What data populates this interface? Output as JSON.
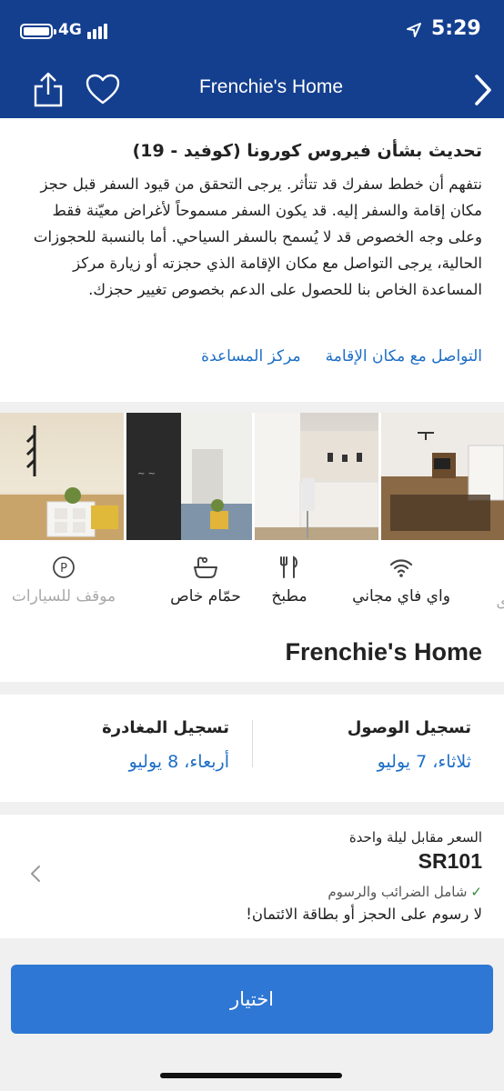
{
  "status_bar": {
    "network": "4G",
    "time": "5:29"
  },
  "nav": {
    "title": "Frenchie's Home"
  },
  "covid": {
    "title": "تحديث بشأن فيروس كورونا (كوفيد - 19)",
    "body": "نتفهم أن خطط سفرك قد تتأثر. يرجى التحقق من قيود السفر قبل حجز مكان إقامة والسفر إليه. قد يكون السفر مسموحاً لأغراض معيّنة فقط وعلى وجه الخصوص قد لا يُسمح بالسفر السياحي. أما بالنسبة للحجوزات الحالية، يرجى التواصل مع مكان الإقامة الذي حجزته أو زيارة مركز المساعدة الخاص بنا للحصول على الدعم بخصوص تغيير حجزك.",
    "link_contact": "التواصل مع مكان الإقامة",
    "link_help": "مركز المساعدة"
  },
  "amenities": [
    {
      "label": "ى",
      "icon": "partial-icon"
    },
    {
      "label": "واي فاي مجاني",
      "icon": "wifi-icon"
    },
    {
      "label": "مطبخ",
      "icon": "kitchen-icon"
    },
    {
      "label": "حمّام خاص",
      "icon": "bath-icon"
    },
    {
      "label": "موقف للسيارات",
      "icon": "parking-icon"
    }
  ],
  "property": {
    "name": "Frenchie's Home"
  },
  "dates": {
    "checkin_label": "تسجيل الوصول",
    "checkin_value": "ثلاثاء، 7 يوليو",
    "checkout_label": "تسجيل المغادرة",
    "checkout_value": "أربعاء، 8 يوليو"
  },
  "price": {
    "label": "السعر مقابل ليلة واحدة",
    "amount": "SR101",
    "taxes": "شامل الضرائب والرسوم",
    "no_fees": "لا رسوم على الحجز أو بطاقة الائتمان!"
  },
  "cta": {
    "select_label": "اختيار"
  },
  "colors": {
    "header": "#143f8f",
    "link": "#1d6ec6",
    "button": "#2f77d4"
  }
}
